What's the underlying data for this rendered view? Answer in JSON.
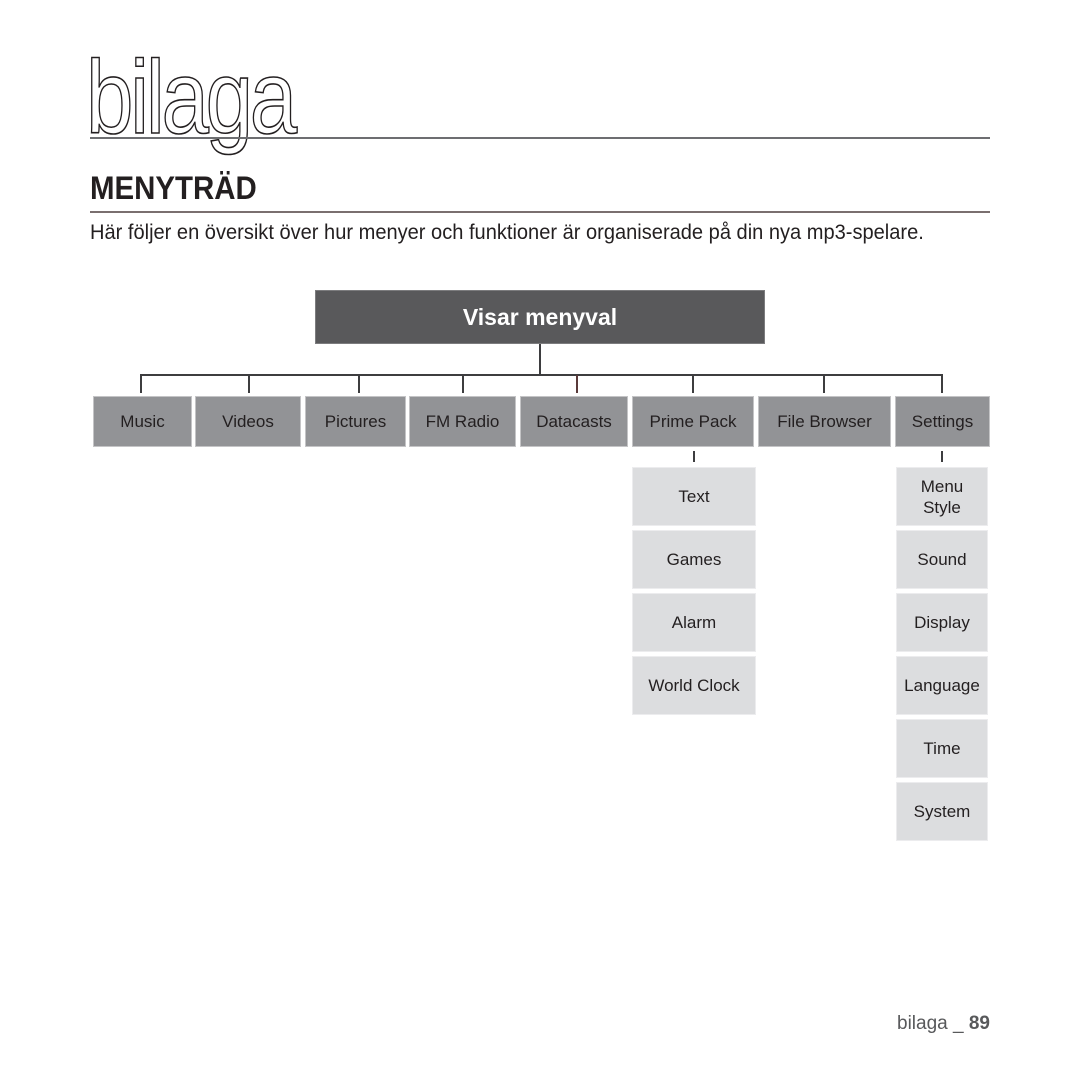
{
  "page": {
    "chapter_title": "bilaga",
    "section_title": "MENYTRÄD",
    "intro": "Här följer en översikt över hur menyer och funktioner är organiserade på din nya mp3-spelare.",
    "footer": {
      "label": "bilaga _",
      "page_number": "89"
    }
  },
  "menu_tree": {
    "root": "Visar menyval",
    "items": [
      {
        "label": "Music"
      },
      {
        "label": "Videos"
      },
      {
        "label": "Pictures"
      },
      {
        "label": "FM Radio"
      },
      {
        "label": "Datacasts"
      },
      {
        "label": "Prime Pack",
        "children": [
          "Text",
          "Games",
          "Alarm",
          "World Clock"
        ]
      },
      {
        "label": "File Browser"
      },
      {
        "label": "Settings",
        "children": [
          "Menu\nStyle",
          "Sound",
          "Display",
          "Language",
          "Time",
          "System"
        ]
      }
    ]
  },
  "colors": {
    "root_fill": "#59595b",
    "level1_fill": "#929396",
    "level2_fill": "#dcdddf",
    "connector": "#3d3d3f"
  }
}
